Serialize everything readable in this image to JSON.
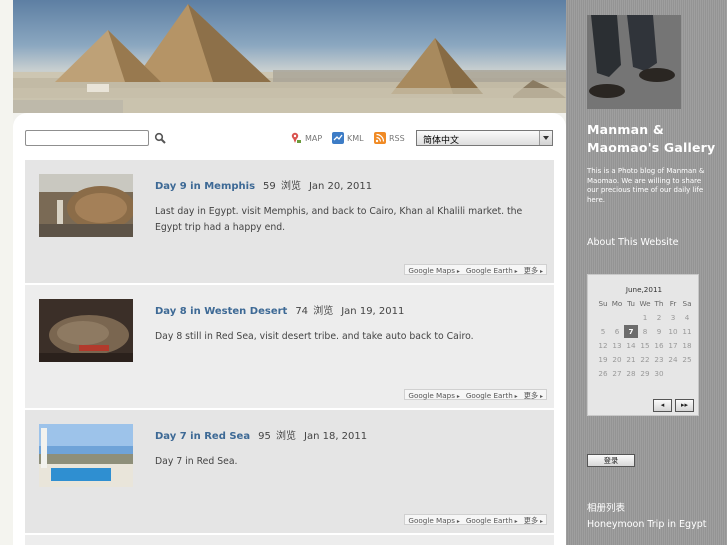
{
  "toolbar": {
    "search_placeholder": "",
    "map_label": "MAP",
    "kml_label": "KML",
    "rss_label": "RSS",
    "language_selected": "简体中文"
  },
  "posts": [
    {
      "title": "Day 9 in Memphis",
      "count": "59",
      "count_label": "浏览",
      "date": "Jan 20, 2011",
      "description": "Last day in Egypt. visit Memphis, and back to Cairo, Khan al Khalili market. the Egypt trip had a happy end.",
      "link_maps": "Google Maps",
      "link_earth": "Google Earth",
      "link_more": "更多"
    },
    {
      "title": "Day 8 in Westen Desert",
      "count": "74",
      "count_label": "浏览",
      "date": "Jan 19, 2011",
      "description": "Day 8 still in Red Sea, visit desert tribe. and take auto back to Cairo.",
      "link_maps": "Google Maps",
      "link_earth": "Google Earth",
      "link_more": "更多"
    },
    {
      "title": "Day 7 in Red Sea",
      "count": "95",
      "count_label": "浏览",
      "date": "Jan 18, 2011",
      "description": "Day 7 in Red Sea.",
      "link_maps": "Google Maps",
      "link_earth": "Google Earth",
      "link_more": "更多"
    }
  ],
  "sidebar": {
    "title": "Manman & Maomao's Gallery",
    "description": "This is a Photo blog of Manman & Maomao. We are willing to share our precious time of our daily life here.",
    "about_link": "About This Website",
    "calendar": {
      "month": "June,2011",
      "weekdays": [
        "Su",
        "Mo",
        "Tu",
        "We",
        "Th",
        "Fr",
        "Sa"
      ],
      "weeks": [
        [
          "",
          "",
          "",
          "1",
          "2",
          "3",
          "4"
        ],
        [
          "5",
          "6",
          "7",
          "8",
          "9",
          "10",
          "11"
        ],
        [
          "12",
          "13",
          "14",
          "15",
          "16",
          "17",
          "18"
        ],
        [
          "19",
          "20",
          "21",
          "22",
          "23",
          "24",
          "25"
        ],
        [
          "26",
          "27",
          "28",
          "29",
          "30",
          "",
          ""
        ]
      ],
      "today": "7",
      "prev_label": "◂",
      "next_label": "▸▸"
    },
    "button_label": "登录",
    "section_heading": "相册列表",
    "album_link": "Honeymoon Trip in Egypt"
  },
  "colors": {
    "link_blue": "#3d6995",
    "sidebar_bg": "#9a9a9a",
    "post_bg": "#e5e5e5"
  }
}
